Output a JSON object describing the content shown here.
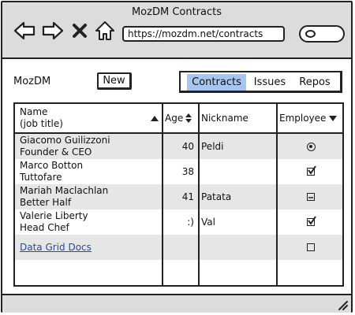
{
  "window": {
    "title": "MozDM Contracts",
    "url": "https://mozdm.net/contracts"
  },
  "toolbar": {
    "app_label": "MozDM",
    "new_label": "New"
  },
  "tabs": [
    {
      "label": "Contracts",
      "active": true
    },
    {
      "label": "Issues",
      "active": false
    },
    {
      "label": "Repos",
      "active": false
    }
  ],
  "grid": {
    "headers": {
      "name": "Name",
      "name_sub": "(job title)",
      "age": "Age",
      "nickname": "Nickname",
      "employee": "Employee"
    },
    "rows": [
      {
        "name": "Giacomo Guilizzoni",
        "title": "Founder & CEO",
        "age": "40",
        "nickname": "Peldi",
        "employee": "radio-selected"
      },
      {
        "name": "Marco Botton",
        "title": "Tuttofare",
        "age": "38",
        "nickname": "",
        "employee": "checked"
      },
      {
        "name": "Mariah Maclachlan",
        "title": "Better Half",
        "age": "41",
        "nickname": "Patata",
        "employee": "indeterminate"
      },
      {
        "name": "Valerie Liberty",
        "title": "Head Chef",
        "age": ":)",
        "nickname": "Val",
        "employee": "checked"
      },
      {
        "name": "Data Grid Docs",
        "title": "",
        "age": "",
        "nickname": "",
        "employee": "unchecked",
        "is_link": true
      }
    ]
  },
  "icons": {
    "back": "arrow-left-icon",
    "forward": "arrow-right-icon",
    "stop": "close-icon",
    "home": "home-icon",
    "search": "search-icon"
  },
  "colors": {
    "accent": "#a6c6ef",
    "chrome": "#dcdcdc",
    "row_alt": "#e6e6e6",
    "link": "#1f4ea8"
  }
}
